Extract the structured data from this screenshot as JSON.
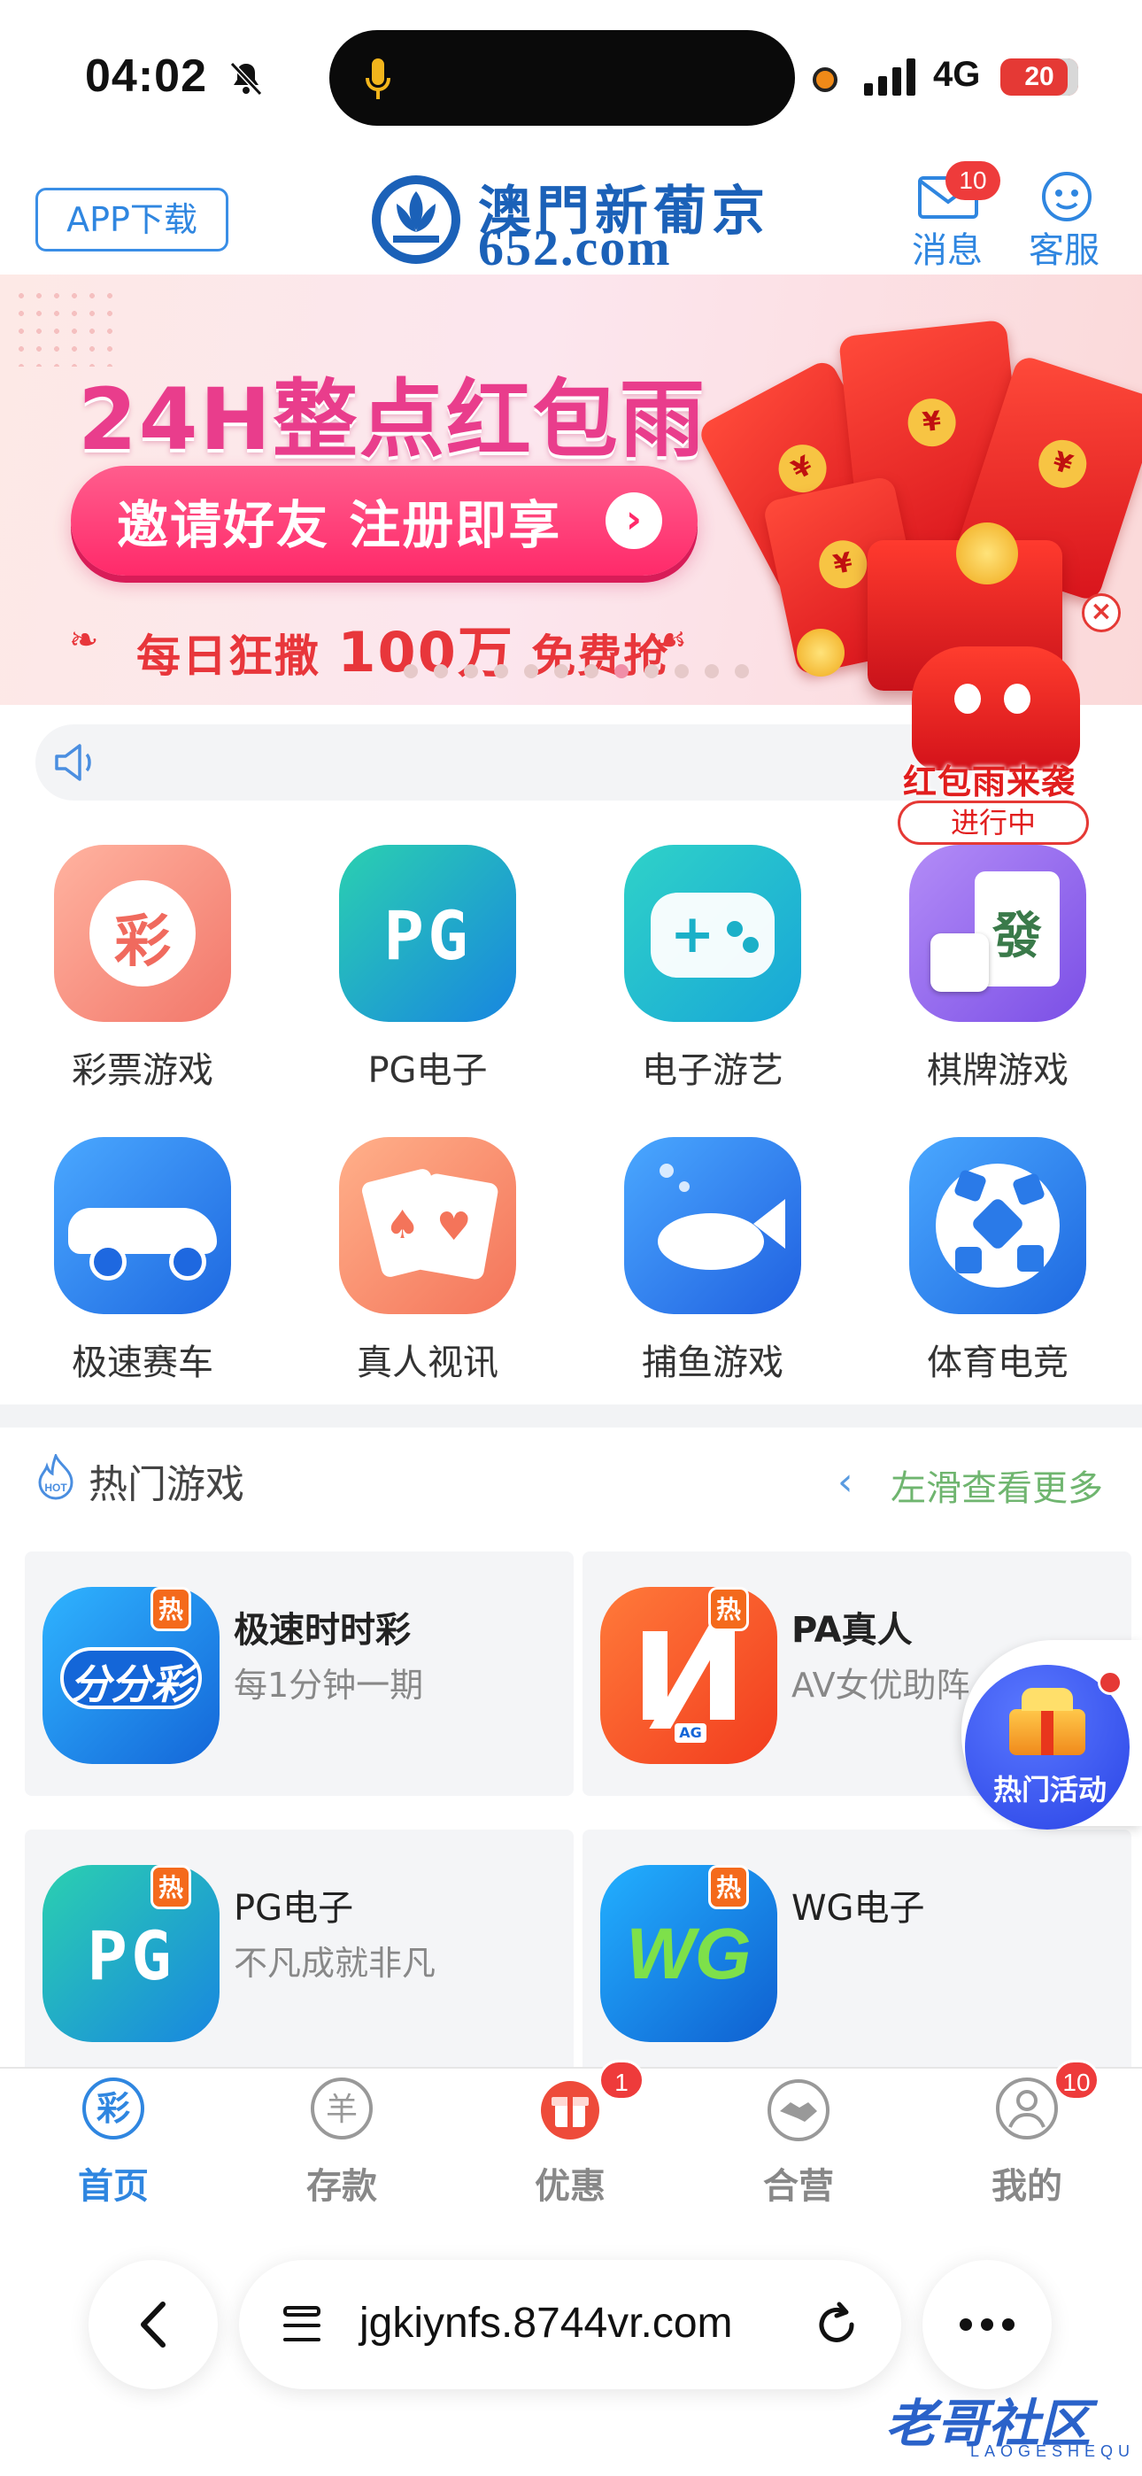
{
  "status_bar": {
    "time": "04:02",
    "network": "4G",
    "battery": "20",
    "icons": [
      "bell-slash-icon",
      "microphone-icon",
      "recording-dot-icon",
      "signal-icon",
      "battery-icon"
    ]
  },
  "header": {
    "app_download": "APP下载",
    "logo_text": "澳門新葡京",
    "logo_domain": "652.com",
    "messages_label": "消息",
    "messages_badge": "10",
    "service_label": "客服"
  },
  "banner": {
    "title": "24H整点红包雨",
    "cta": "邀请好友 注册即享",
    "sub_prefix": "每日狂撒",
    "sub_number": "100万",
    "sub_suffix": "免费抢",
    "slide_count": 12,
    "active_slide": 7
  },
  "red_packet_widget": {
    "title": "红包雨来袭",
    "status": "进行中"
  },
  "categories": [
    {
      "label": "彩票游戏",
      "icon": "lottery-icon"
    },
    {
      "label": "PG电子",
      "icon": "pg-icon"
    },
    {
      "label": "电子游艺",
      "icon": "gamepad-icon"
    },
    {
      "label": "棋牌游戏",
      "icon": "mahjong-icon"
    },
    {
      "label": "极速赛车",
      "icon": "car-icon"
    },
    {
      "label": "真人视讯",
      "icon": "cards-icon"
    },
    {
      "label": "捕鱼游戏",
      "icon": "fish-icon"
    },
    {
      "label": "体育电竞",
      "icon": "soccer-ball-icon"
    }
  ],
  "hot_games": {
    "title": "热门游戏",
    "more": "左滑查看更多",
    "badge": "热",
    "items": [
      {
        "title": "极速时时彩",
        "subtitle": "每1分钟一期",
        "icon_text": "分分彩"
      },
      {
        "title": "PA真人",
        "subtitle": "AV女优助阵",
        "icon_text": "AG"
      },
      {
        "title": "PG电子",
        "subtitle": "不凡成就非凡",
        "icon_text": "PG"
      },
      {
        "title": "WG电子",
        "subtitle": "",
        "icon_text": "WG"
      }
    ]
  },
  "floating_activity": {
    "label": "热门活动"
  },
  "tabbar": {
    "items": [
      {
        "label": "首页",
        "glyph": "彩",
        "active": true
      },
      {
        "label": "存款",
        "glyph": "羊"
      },
      {
        "label": "优惠",
        "badge": "1"
      },
      {
        "label": "合营"
      },
      {
        "label": "我的",
        "badge": "10"
      }
    ]
  },
  "browser": {
    "url": "jgkiynfs.8744vr.com"
  },
  "watermark": {
    "text": "老哥社区",
    "sub": "LAOGESHEQU"
  },
  "colors": {
    "primary_blue": "#2f86e0",
    "brand_blue": "#1b61b8",
    "banner_pink": "#e93d8c",
    "red": "#e53935",
    "green_text": "#6fb56f"
  }
}
